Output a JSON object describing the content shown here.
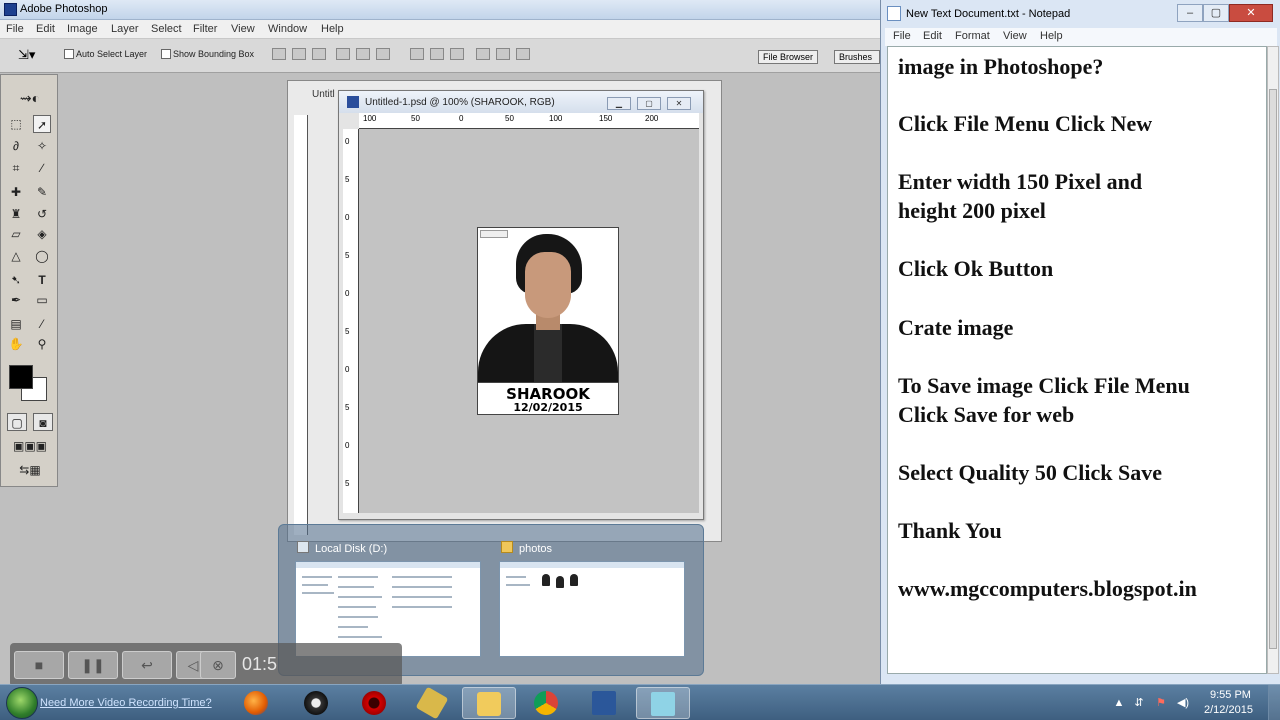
{
  "photoshop": {
    "title": "Adobe Photoshop",
    "menu": [
      "File",
      "Edit",
      "Image",
      "Layer",
      "Select",
      "Filter",
      "View",
      "Window",
      "Help"
    ],
    "options": {
      "auto_select_label": "Auto Select Layer",
      "show_bounding_label": "Show Bounding Box",
      "file_browser_label": "File Browser",
      "brushes_label": "Brushes"
    },
    "back_doc_title": "Untitl",
    "doc": {
      "title": "Untitled-1.psd @ 100% (SHAROOK, RGB)",
      "ruler_h": [
        "100",
        "50",
        "0",
        "50",
        "100",
        "150",
        "200"
      ],
      "ruler_v": [
        "0",
        "5",
        "0",
        "5",
        "0",
        "5",
        "0",
        "5",
        "0",
        "5"
      ]
    },
    "card": {
      "name": "SHAROOK",
      "date": "12/02/2015"
    }
  },
  "notepad": {
    "title": "New Text Document.txt - Notepad",
    "menu": [
      "File",
      "Edit",
      "Format",
      "View",
      "Help"
    ],
    "lines": [
      "image in Photoshope?",
      "Click File Menu Click New",
      "Enter width 150 Pixel  and",
      "height 200 pixel",
      "Click Ok Button",
      "Crate image",
      "To Save image Click File Menu",
      "Click Save for web",
      "Select Quality 50 Click Save",
      "Thank You",
      "www.mgccomputers.blogspot.in"
    ]
  },
  "thumbnails": [
    {
      "title": "Local Disk (D:)"
    },
    {
      "title": "photos"
    }
  ],
  "recorder": {
    "time": "01:5",
    "promo": "Need More Video Recording Time?"
  },
  "taskbar": {
    "apps": [
      "Firefox",
      "Media Player",
      "Opera",
      "Tools",
      "Explorer",
      "Chrome",
      "Word",
      "Notepad"
    ],
    "clock_time": "9:55 PM",
    "clock_date": "2/12/2015"
  },
  "colors": {
    "taskbar": "#4a6b8d",
    "foreground_swatch": "#000000",
    "background_swatch": "#ffffff"
  }
}
